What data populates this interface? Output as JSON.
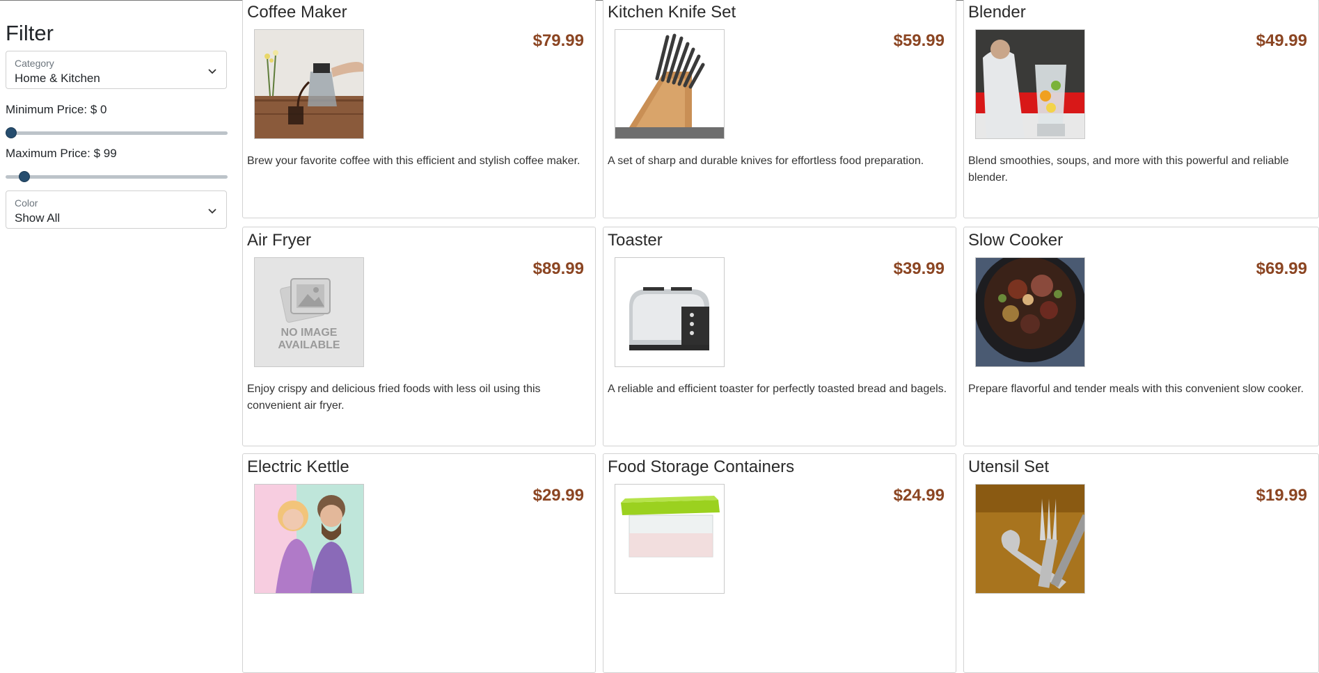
{
  "filter": {
    "title": "Filter",
    "category": {
      "label": "Category",
      "value": "Home & Kitchen"
    },
    "min_price": {
      "label": "Minimum Price: $ 0",
      "value": 0
    },
    "max_price": {
      "label": "Maximum Price: $ 99",
      "value": 99
    },
    "color": {
      "label": "Color",
      "value": "Show All"
    }
  },
  "products": [
    {
      "name": "Coffee Maker",
      "price": "$79.99",
      "description": "Brew your favorite coffee with this efficient and stylish coffee maker."
    },
    {
      "name": "Kitchen Knife Set",
      "price": "$59.99",
      "description": "A set of sharp and durable knives for effortless food preparation."
    },
    {
      "name": "Blender",
      "price": "$49.99",
      "description": "Blend smoothies, soups, and more with this powerful and reliable blender."
    },
    {
      "name": "Air Fryer",
      "price": "$89.99",
      "description": "Enjoy crispy and delicious fried foods with less oil using this convenient air fryer.",
      "image_text": [
        "NO IMAGE",
        "AVAILABLE"
      ]
    },
    {
      "name": "Toaster",
      "price": "$39.99",
      "description": "A reliable and efficient toaster for perfectly toasted bread and bagels."
    },
    {
      "name": "Slow Cooker",
      "price": "$69.99",
      "description": "Prepare flavorful and tender meals with this convenient slow cooker."
    },
    {
      "name": "Electric Kettle",
      "price": "$29.99",
      "description": ""
    },
    {
      "name": "Food Storage Containers",
      "price": "$24.99",
      "description": ""
    },
    {
      "name": "Utensil Set",
      "price": "$19.99",
      "description": ""
    }
  ],
  "colors": {
    "price": "#8b4522",
    "slider_thumb": "#264d6e"
  }
}
